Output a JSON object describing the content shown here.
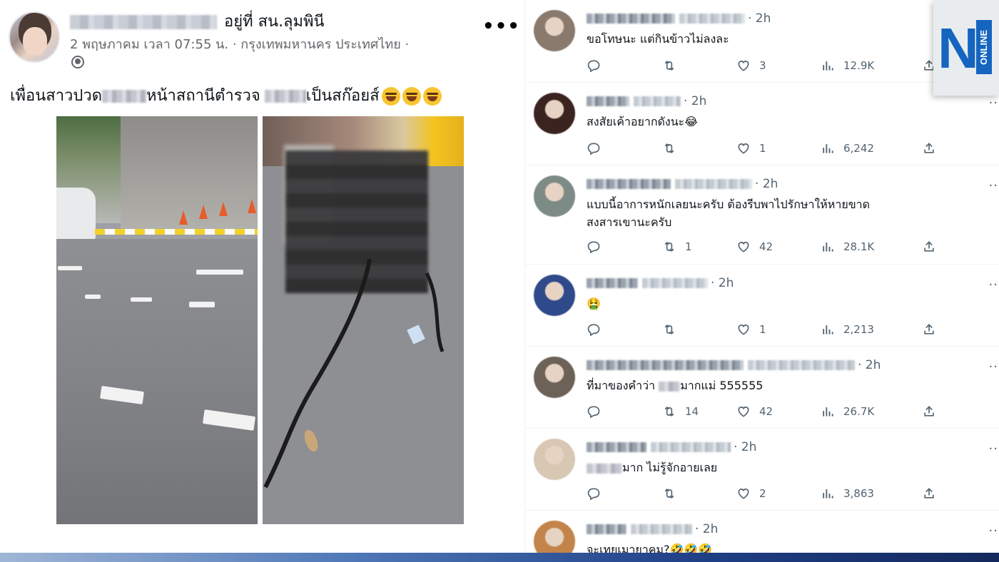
{
  "post": {
    "author_suffix": "อยู่ที่ สน.ลุมพินี",
    "meta": "2 พฤษภาคม เวลา 07:55 น. · กรุงเทพมหานคร ประเทศไทย ·",
    "caption_part1": "เพื่อนสาวปวด",
    "caption_part2": "หน้าสถานีตำรวจ",
    "caption_part3": "เป็นสก๊อยส์",
    "more_label": "•••"
  },
  "replies": [
    {
      "time": "· 2h",
      "text": "ขอโทษนะ แต่กินข้าวไม่ลงละ",
      "reply": "",
      "retweets": "",
      "likes": "3",
      "views": "12.9K",
      "avatar_color": "#8a7a6e"
    },
    {
      "time": "· 2h",
      "text": "สงสัยเค้าอยากดังนะ😂",
      "reply": "",
      "retweets": "",
      "likes": "1",
      "views": "6,242",
      "avatar_color": "#3b2420"
    },
    {
      "time": "· 2h",
      "text": "แบบนี้อาการหนักเลยนะครับ ต้องรีบพาไปรักษาให้หายขาด",
      "text2": "สงสารเขานะครับ",
      "reply": "",
      "retweets": "1",
      "likes": "42",
      "views": "28.1K",
      "avatar_color": "#7d8b86"
    },
    {
      "time": "· 2h",
      "text": "🤮",
      "reply": "",
      "retweets": "",
      "likes": "1",
      "views": "2,213",
      "avatar_color": "#2f4a8a"
    },
    {
      "time": "· 2h",
      "text_pre": "ที่มาของคำว่า ",
      "text": "มากแม่ 555555",
      "reply": "",
      "retweets": "14",
      "likes": "42",
      "views": "26.7K",
      "avatar_color": "#6d6258"
    },
    {
      "time": "· 2h",
      "text": "มาก ไม่รู้จักอายเลย",
      "reply": "",
      "retweets": "",
      "likes": "2",
      "views": "3,863",
      "avatar_color": "#d8c7b3"
    },
    {
      "time": "· 2h",
      "text": "จะเทยเมายาคม?🤣🤣🤣",
      "avatar_color": "#c2844a"
    }
  ],
  "logo": {
    "letter": "N",
    "tag": "ONLINE"
  },
  "colors": {
    "fb_meta": "#65676b",
    "tw_meta": "#536471",
    "logo_blue": "#1565c0"
  }
}
